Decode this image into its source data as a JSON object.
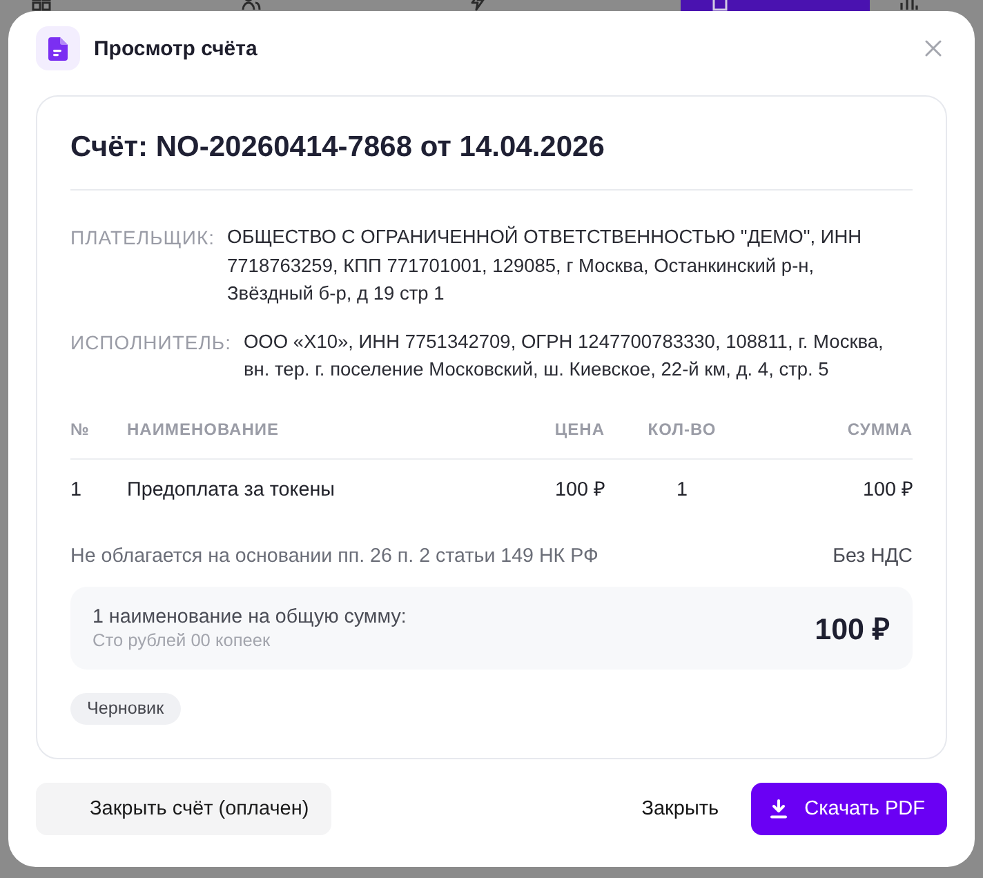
{
  "background_tabs": [
    {
      "selected": false
    },
    {
      "selected": false
    },
    {
      "selected": false
    },
    {
      "selected": true
    },
    {
      "selected": false
    }
  ],
  "dialog": {
    "title": "Просмотр счёта"
  },
  "invoice": {
    "title": "Счёт: NO-20260414-7868 от 14.04.2026",
    "parties": [
      {
        "label": "ПЛАТЕЛЬЩИК:",
        "value": "ОБЩЕСТВО С ОГРАНИЧЕННОЙ ОТВЕТСТВЕННОСТЬЮ \"ДЕМО\", ИНН 7718763259, КПП 771701001, 129085, г Москва, Останкинский р-н, Звёздный б-р, д 19 стр 1"
      },
      {
        "label": "ИСПОЛНИТЕЛЬ:",
        "value": "ООО «Х10», ИНН 7751342709, ОГРН 1247700783330, 108811, г. Москва, вн. тер. г. поселение Московский, ш. Киевское, 22-й км, д. 4, стр. 5"
      }
    ],
    "table": {
      "columns": [
        "№",
        "НАИМЕНОВАНИЕ",
        "ЦЕНА",
        "КОЛ-ВО",
        "СУММА"
      ],
      "rows": [
        [
          "1",
          "Предоплата за токены",
          "100 ₽",
          "1",
          "100 ₽"
        ]
      ]
    },
    "tax_note": "Не облагается на основании пп. 26 п. 2 статьи 149 НК РФ",
    "tax_status": "Без НДС",
    "total": {
      "label": "1 наименование на общую сумму:",
      "in_words": "Сто рублей 00 копеек",
      "amount": "100 ₽"
    },
    "status_badge": "Черновик"
  },
  "buttons": [
    {
      "label": "Закрыть счёт (оплачен)",
      "kind": "secondary"
    },
    {
      "label": "Закрыть",
      "kind": "text"
    },
    {
      "label": "Скачать PDF",
      "kind": "primary"
    }
  ]
}
